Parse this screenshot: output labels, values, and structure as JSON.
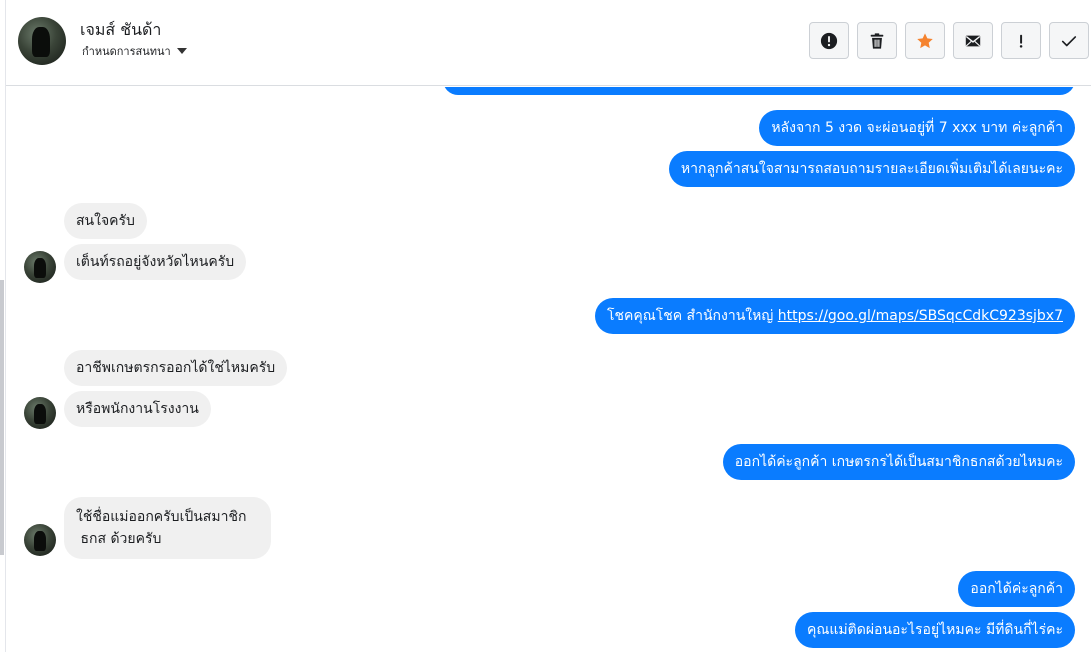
{
  "header": {
    "contact_name": "เจมส์ ชันด้า",
    "contact_sub": "กำหนดการสนทนา",
    "actions": [
      {
        "name": "alert-icon",
        "label": "alert"
      },
      {
        "name": "trash-icon",
        "label": "delete"
      },
      {
        "name": "star-icon",
        "label": "star"
      },
      {
        "name": "envelope-icon",
        "label": "mark unread"
      },
      {
        "name": "exclamation-icon",
        "label": "important"
      },
      {
        "name": "check-icon",
        "label": "done"
      }
    ]
  },
  "colors": {
    "outgoing_bubble": "#0a7cff",
    "incoming_bubble": "#f0f0f0",
    "star": "#f5832f"
  },
  "messages": {
    "m1": "หลังจาก 5 งวด จะผ่อนอยู่ที่ 7 xxx บาท ค่ะลูกค้า",
    "m2": "หากลูกค้าสนใจสามารถสอบถามรายละเอียดเพิ่มเติมได้เลยนะคะ",
    "m3": "สนใจครับ",
    "m4": "เต็นท์รถอยู่จังหวัดไหนครับ",
    "m5_text": "โชคคุณโชค สำนักงานใหญ่ ",
    "m5_link": "https://goo.gl/maps/SBSqcCdkC923sjbx7",
    "m6": "อาชีพเกษตรกรออกได้ใช่ไหมครับ",
    "m7": "หรือพนักงานโรงงาน",
    "m8": "ออกได้ค่ะลูกค้า เกษตรกรได้เป็นสมาชิกธกสด้วยไหมคะ",
    "m9_line1": "ใช้ชื่อแม่ออกครับเป็นสมาชิก",
    "m9_line2": " ธกส ด้วยครับ",
    "m10": "ออกได้ค่ะลูกค้า",
    "m11": "คุณแม่ติดผ่อนอะไรอยู่ไหมคะ มีที่ดินกี่ไร่คะ"
  }
}
